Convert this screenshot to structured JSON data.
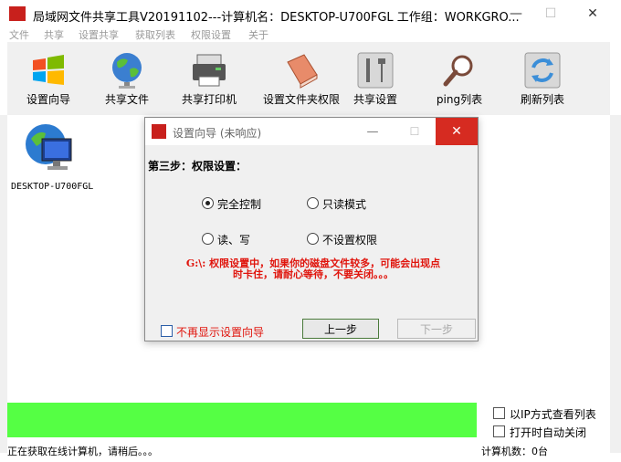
{
  "window": {
    "title": "局域网文件共享工具V20191102---计算机名：DESKTOP-U700FGL  工作组：WORKGRO...",
    "minimize": "—",
    "maximize": "☐",
    "close": "✕"
  },
  "menu": [
    "文件",
    "共享",
    "设置共享",
    "获取列表",
    "权限设置",
    "关于"
  ],
  "toolbar": [
    {
      "label": "设置向导",
      "icon": "windows-logo-icon"
    },
    {
      "label": "共享文件",
      "icon": "globe-icon"
    },
    {
      "label": "共享打印机",
      "icon": "printer-icon"
    },
    {
      "label": "设置文件夹权限",
      "icon": "book-icon"
    },
    {
      "label": "共享设置",
      "icon": "tools-icon"
    },
    {
      "label": "ping列表",
      "icon": "magnifier-icon"
    },
    {
      "label": "刷新列表",
      "icon": "refresh-icon"
    }
  ],
  "computer": {
    "name": "DESKTOP-U700FGL"
  },
  "dialog": {
    "title": "设置向导 (未响应)",
    "step": "第三步：权限设置：",
    "options": {
      "full": "完全控制",
      "readonly": "只读模式",
      "readwrite": "读、写",
      "none": "不设置权限"
    },
    "selected": "full",
    "warning_line1": "G:\\: 权限设置中，如果你的磁盘文件较多，可能会出现点",
    "warning_line2": "时卡住，请耐心等待，不要关闭。。。",
    "no_show": "不再显示设置向导",
    "prev": "上一步",
    "next": "下一步",
    "min": "—",
    "max": "☐",
    "close": "✕"
  },
  "sidebar_right": {
    "ip_view": "以IP方式查看列表",
    "auto": "打开时自动关闭"
  },
  "status": {
    "left": "正在获取在线计算机，请稍后。。。",
    "right": "计算机数：0台"
  },
  "colors": {
    "green_bar": "#55ff44",
    "close_red": "#d62b21",
    "warning_red": "#e0140c"
  }
}
